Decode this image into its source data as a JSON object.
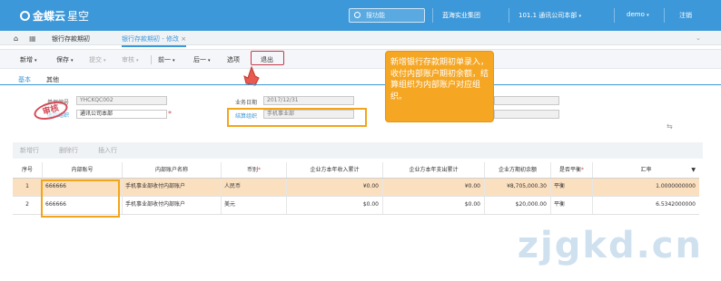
{
  "topbar": {
    "brand_text": "金蝶云",
    "brand_sub": "星空",
    "search_placeholder": "搜功能",
    "org": "蓝海实业集团",
    "account": "101.1 通讯公司本部",
    "user": "demo",
    "logout": "注销",
    "bg": "#3d98d9"
  },
  "tabs": {
    "items": [
      {
        "label": "银行存款期初"
      },
      {
        "label": "银行存款期初 - 修改"
      }
    ]
  },
  "toolbar": {
    "items": [
      "新增",
      "保存",
      "提交",
      "审核",
      "前一",
      "后一",
      "选项",
      "退出"
    ]
  },
  "subtabs": [
    "基本",
    "其他"
  ],
  "form": {
    "bill_no_label": "单据编号",
    "bill_no": "YHCKQC002",
    "org_label": "收款组织",
    "org": "通讯公司本部",
    "biz_date_label": "业务日期",
    "biz_date": "2017/12/31",
    "settle_org_label": "结算组织",
    "settle_org": "手机事业部",
    "stamp": "审核"
  },
  "callout": "新增银行存款期初单录入，收付内部账户期初余额，结算组织为内部账户对应组织。",
  "grid_toolbar": [
    "新增行",
    "删除行",
    "插入行"
  ],
  "grid": {
    "headers": [
      "序号",
      "内部账号",
      "内部账户名称",
      "币别",
      "企业方本年收入累计",
      "企业方本年支出累计",
      "企业方期初余额",
      "是否平衡",
      "汇率"
    ],
    "rows": [
      {
        "no": "1",
        "acct": "666666",
        "name": "手机事业部收付内部账户",
        "cur": "人民币",
        "inc": "¥0.00",
        "exp": "¥0.00",
        "bal": "¥8,705,000.30",
        "eq": "平衡",
        "rate": "1.0000000000"
      },
      {
        "no": "2",
        "acct": "666666",
        "name": "手机事业部收付内部账户",
        "cur": "美元",
        "inc": "$0.00",
        "exp": "$0.00",
        "bal": "$20,000.00",
        "eq": "平衡",
        "rate": "6.5342000000"
      }
    ]
  },
  "watermark": "zjgkd.cn",
  "colors": {
    "accent": "#3d98d9",
    "highlight": "#f5a623",
    "selected_row": "#fbe0c0"
  }
}
